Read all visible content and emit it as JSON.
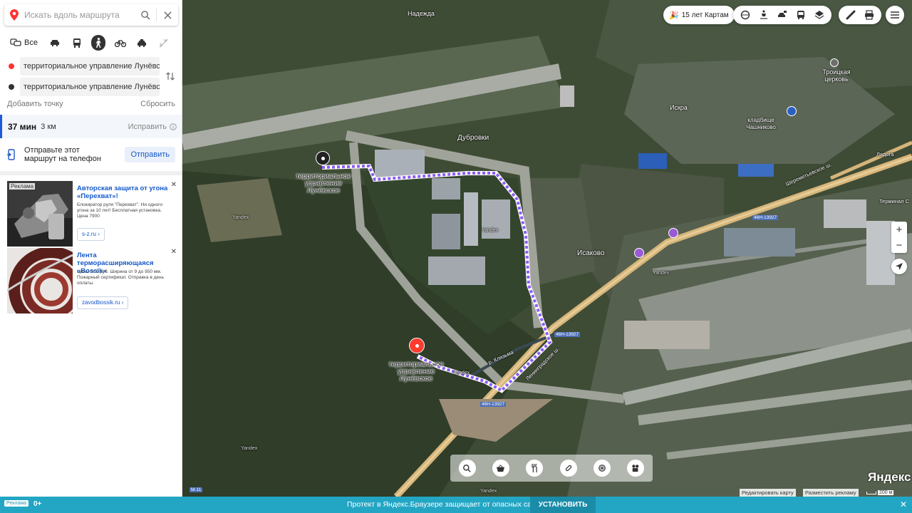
{
  "search": {
    "placeholder": "Искать вдоль маршрута"
  },
  "modes": {
    "all_label": "Все"
  },
  "route_points": {
    "from": "территориальное управление Лунёвское",
    "to": "территориальное управление Лунёвское"
  },
  "actions": {
    "add_point": "Добавить точку",
    "reset": "Сбросить"
  },
  "route": {
    "time": "37 мин",
    "distance": "3 км",
    "fix": "Исправить"
  },
  "send": {
    "text": "Отправьте этот маршрут на телефон",
    "button": "Отправить"
  },
  "ads": [
    {
      "tag": "Реклама",
      "title": "Авторская защита от угона «Перехват»!",
      "desc": "Блокиратор руля \"Перехват\". Ни одного угона за 10 лет! Бесплатная установка. Цена 7900",
      "link": "s-z.ru"
    },
    {
      "title": "Лента терморасширяющаяся «Bossik»",
      "desc": "Цены от 9 руб. Ширина от 9 до 950 мм. Пожарный сертификат. Отправка в день оплаты.",
      "link": "zavodbossik.ru"
    }
  ],
  "map": {
    "places": {
      "nadezhda": "Надежда",
      "dubrovki": "Дубровки",
      "iskra": "Искра",
      "isakovo": "Исаково",
      "troitskaya": "Троицкая церковь",
      "cemetery": "кладбище Чашниково",
      "terminal": "Терминал С",
      "klyazma": "р. Клязьма",
      "ladoga": "Ладога",
      "sheremetyevskoe": "Шереметьевское ш.",
      "leningradskoe": "Ленинградское ш.",
      "yandex": "Yandex"
    },
    "road_shields": {
      "r1": "46Н-13927",
      "r2": "46Н-13927",
      "r3": "46Н-13927",
      "m11": "М-11"
    },
    "start_label": "территориальное управление Лунёвское",
    "end_label": "территориальное управление Лунёвское",
    "promo": "15 лет Картам",
    "logo": "Яндекс",
    "edit_map": "Редактировать карту",
    "place_ad": "Разместить рекламу",
    "scale": "200 м",
    "route_color": "#8b5cf6"
  },
  "banner": {
    "ad": "Реклама",
    "age": "0+",
    "text": "Протект в Яндекс.Браузере защищает от опасных сайтов",
    "install": "УСТАНОВИТЬ"
  }
}
